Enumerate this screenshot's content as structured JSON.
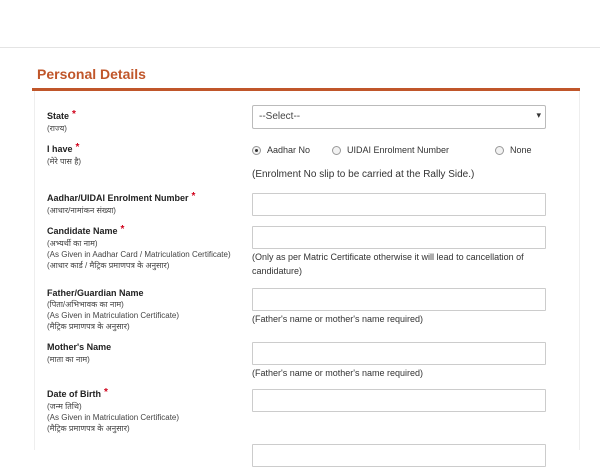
{
  "section": {
    "title": "Personal Details"
  },
  "fields": {
    "state": {
      "label": "State",
      "sub": [
        "(राज्य)"
      ],
      "select_value": "--Select--"
    },
    "i_have": {
      "label": "I have",
      "sub": [
        "(मेरे पास है)"
      ],
      "options": [
        "Aadhar No",
        "UIDAI Enrolment Number",
        "None"
      ],
      "selected": "Aadhar No",
      "note": "(Enrolment No slip to be carried at the Rally Side.)"
    },
    "aadhar": {
      "label": "Aadhar/UIDAI Enrolment Number",
      "sub": [
        "(आधार/नामांकन संख्या)"
      ]
    },
    "candidate": {
      "label": "Candidate Name",
      "sub": [
        "(अभ्यर्थी का नाम)",
        "(As Given in Aadhar Card / Matriculation Certificate)",
        "(आधार कार्ड / मैट्रिक प्रमाणपत्र के अनुसार)"
      ],
      "hint": [
        "(Only as per Matric Certificate otherwise it will lead to cancellation of",
        "candidature)"
      ]
    },
    "father": {
      "label": "Father/Guardian Name",
      "sub": [
        "(पिता/अभिभावक का नाम)",
        "(As Given in Matriculation Certificate)",
        "(मैट्रिक प्रमाणपत्र के अनुसार)"
      ],
      "hint": "(Father's name or mother's name required)"
    },
    "mother": {
      "label": "Mother's Name",
      "sub": [
        "(माता का नाम)"
      ],
      "hint": "(Father's name or mother's name required)"
    },
    "dob": {
      "label": "Date of Birth",
      "sub": [
        "(जन्म तिथि)",
        "(As Given in Matriculation Certificate)",
        "(मैट्रिक प्रमाणपत्र के अनुसार)"
      ]
    }
  },
  "required_mark": "*",
  "caret": "▾"
}
